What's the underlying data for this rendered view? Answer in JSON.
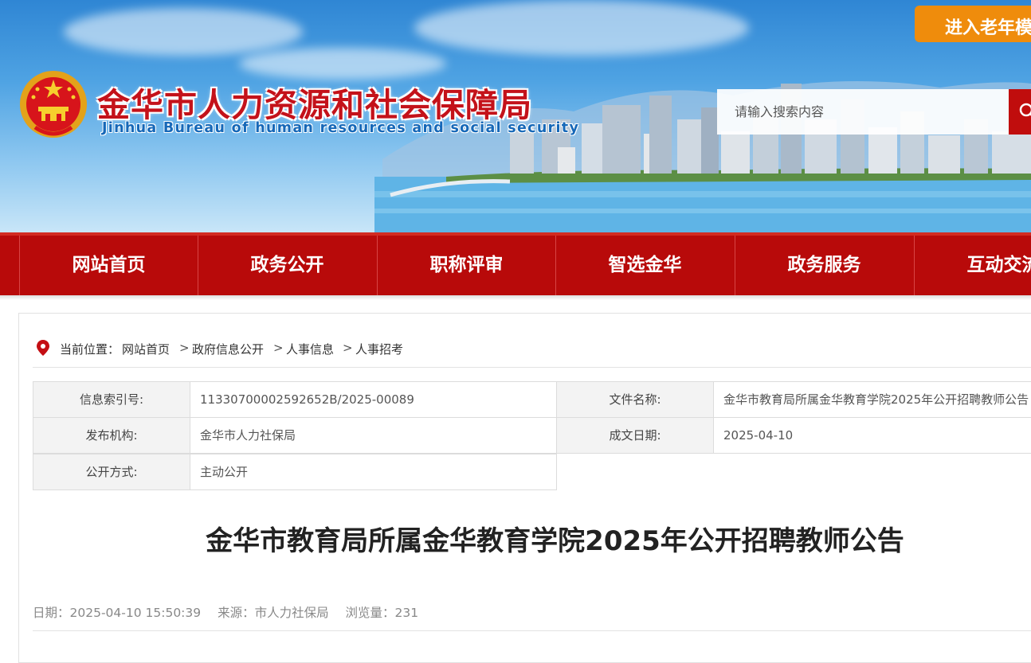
{
  "header": {
    "title_cn": "金华市人力资源和社会保障局",
    "title_en": "Jinhua Bureau of human resources and social security",
    "elder_button": "进入老年模式",
    "search_placeholder": "请输入搜索内容",
    "search_icon": "search-icon",
    "emblem_icon": "national-emblem-icon"
  },
  "colors": {
    "brand_red": "#b80a0a",
    "accent_orange": "#ef8c0c",
    "title_red": "#c4121a"
  },
  "nav": {
    "items": [
      "网站首页",
      "政务公开",
      "职称评审",
      "智选金华",
      "政务服务",
      "互动交流"
    ]
  },
  "breadcrumb": {
    "label": "当前位置：",
    "items": [
      "网站首页",
      "政府信息公开",
      "人事信息",
      "人事招考"
    ],
    "separator": ">"
  },
  "info": {
    "index_label": "信息索引号:",
    "index_value": "11330700002592652B/2025-00089",
    "file_name_label": "文件名称:",
    "file_name_value": "金华市教育局所属金华教育学院2025年公开招聘教师公告",
    "publisher_label": "发布机构:",
    "publisher_value": "金华市人力社保局",
    "date_label": "成文日期:",
    "date_value": "2025-04-10",
    "method_label": "公开方式:",
    "method_value": "主动公开"
  },
  "article": {
    "title": "金华市教育局所属金华教育学院2025年公开招聘教师公告",
    "date_text": "日期：2025-04-10 15:50:39",
    "source_text": "来源：市人力社保局",
    "views_text": "浏览量：231"
  }
}
